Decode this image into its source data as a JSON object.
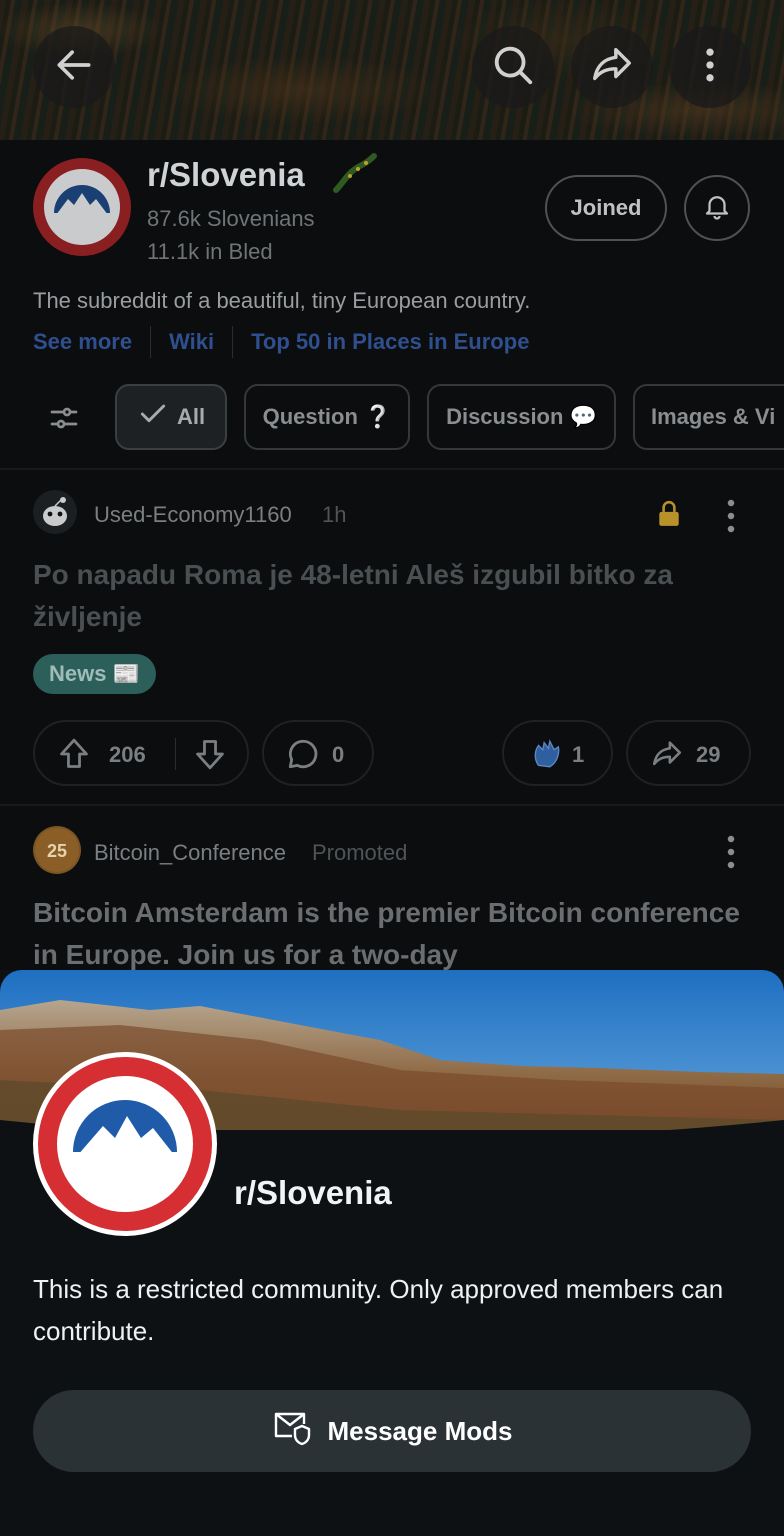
{
  "top_bar": {
    "back_icon": "arrow-left-icon",
    "search_icon": "search-icon",
    "share_icon": "share-icon",
    "more_icon": "more-vertical-icon"
  },
  "subreddit": {
    "name": "r/Slovenia",
    "members": "87.6k Slovenians",
    "online": "11.1k in Bled",
    "joined_label": "Joined",
    "description": "The subreddit of a beautiful, tiny European country.",
    "links": [
      "See more",
      "Wiki",
      "Top 50 in Places in Europe"
    ],
    "accent_link_color": "#2f4f8f"
  },
  "filters": {
    "chips": [
      "All",
      "Question ❔",
      "Discussion 💬",
      "Images & Vi"
    ]
  },
  "post1": {
    "author": "Used-Economy1160",
    "time": "1h",
    "title": "Po napadu Roma je 48-letni Aleš izgubil bitko za življenje",
    "flair": "News 📰",
    "upvotes": "206",
    "comments": "0",
    "awards": "1",
    "shares": "29"
  },
  "post2": {
    "author": "Bitcoin_Conference",
    "promoted": "Promoted",
    "title": "Bitcoin Amsterdam is the premier Bitcoin conference in Europe. Join us for a two-day"
  },
  "sheet": {
    "name": "r/Slovenia",
    "text": "This is a restricted community. Only approved members can contribute.",
    "button_label": "Message Mods",
    "button_icon": "mail-shield-icon"
  },
  "colors": {
    "background": "#0e1113",
    "button": "#2a3236",
    "logo_red": "#d52f34",
    "logo_blue": "#1f5ba8",
    "flair_teal": "#2c5f5a"
  }
}
